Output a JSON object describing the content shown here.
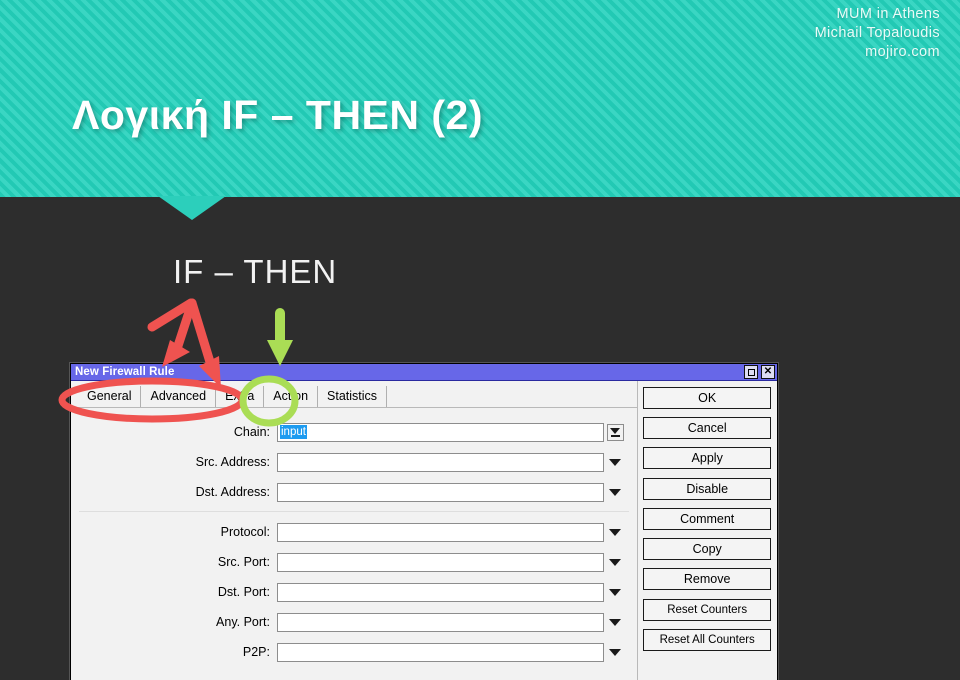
{
  "header": {
    "line1": "MUM in Athens",
    "line2": "Michail Topaloudis",
    "line3": "mojiro.com"
  },
  "slide": {
    "title": "Λογική IF – THEN (2)",
    "subtitle": "IF – THEN"
  },
  "colors": {
    "banner_teal": "#22c9b4",
    "banner_teal_light": "#3ad6c3",
    "body_dark": "#2d2d2d",
    "titlebar_blue": "#6767e8",
    "annotation_red": "#ef5350",
    "annotation_green": "#aadd55",
    "selection_blue": "#1d9bf0"
  },
  "dialog": {
    "title": "New Firewall Rule",
    "window_buttons": [
      {
        "name": "maximize-button",
        "glyph": "□"
      },
      {
        "name": "close-button",
        "glyph": "✕"
      }
    ],
    "tabs": [
      {
        "label": "General",
        "active": true
      },
      {
        "label": "Advanced",
        "active": false
      },
      {
        "label": "Extra",
        "active": false
      },
      {
        "label": "Action",
        "active": false
      },
      {
        "label": "Statistics",
        "active": false
      }
    ],
    "fields": [
      {
        "label": "Chain:",
        "value": "input",
        "selected": true,
        "control": "boxed-dropdown"
      },
      {
        "label": "Src. Address:",
        "value": "",
        "selected": false,
        "control": "dropdown"
      },
      {
        "label": "Dst. Address:",
        "value": "",
        "selected": false,
        "control": "dropdown"
      },
      {
        "label": "Protocol:",
        "value": "",
        "selected": false,
        "control": "dropdown"
      },
      {
        "label": "Src. Port:",
        "value": "",
        "selected": false,
        "control": "dropdown"
      },
      {
        "label": "Dst. Port:",
        "value": "",
        "selected": false,
        "control": "dropdown"
      },
      {
        "label": "Any. Port:",
        "value": "",
        "selected": false,
        "control": "dropdown"
      },
      {
        "label": "P2P:",
        "value": "",
        "selected": false,
        "control": "dropdown"
      }
    ],
    "buttons": [
      "OK",
      "Cancel",
      "Apply",
      "Disable",
      "Comment",
      "Copy",
      "Remove",
      "Reset Counters",
      "Reset All Counters"
    ]
  },
  "annotations": {
    "red_ellipse_target": "General / Advanced / Extra tabs",
    "green_ellipse_target": "Action tab",
    "red_arrows": 2,
    "green_arrows": 1
  }
}
